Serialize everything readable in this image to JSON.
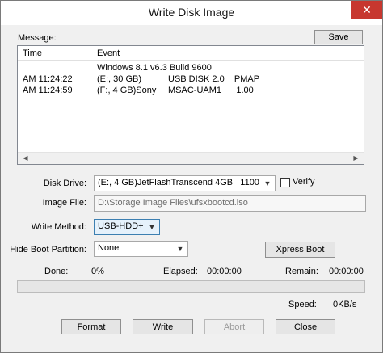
{
  "window": {
    "title": "Write Disk Image",
    "close_glyph": "✕"
  },
  "message": {
    "label": "Message:",
    "save_label": "Save",
    "columns": [
      "Time",
      "Event"
    ],
    "rows": [
      {
        "time": "",
        "event": "Windows 8.1 v6.3 Build 9600",
        "extra": ""
      },
      {
        "time": "AM 11:24:22",
        "event": "(E:, 30 GB)",
        "extra": "USB DISK 2.0    PMAP"
      },
      {
        "time": "AM 11:24:59",
        "event": "(F:, 4 GB)Sony",
        "extra": "MSAC-UAM1      1.00"
      }
    ]
  },
  "form": {
    "disk_drive_label": "Disk Drive:",
    "disk_drive_value": "(E:, 4 GB)JetFlashTranscend 4GB   1100",
    "verify_label": "Verify",
    "verify_checked": false,
    "image_file_label": "Image File:",
    "image_file_value": "D:\\Storage Image Files\\ufsxbootcd.iso",
    "write_method_label": "Write Method:",
    "write_method_value": "USB-HDD+",
    "hide_boot_label": "Hide Boot Partition:",
    "hide_boot_value": "None",
    "xpress_boot_label": "Xpress Boot"
  },
  "status": {
    "done_label": "Done:",
    "done_value": "0%",
    "elapsed_label": "Elapsed:",
    "elapsed_value": "00:00:00",
    "remain_label": "Remain:",
    "remain_value": "00:00:00",
    "speed_label": "Speed:",
    "speed_value": "0KB/s",
    "progress": 0
  },
  "buttons": {
    "format": "Format",
    "write": "Write",
    "abort": "Abort",
    "close": "Close"
  }
}
